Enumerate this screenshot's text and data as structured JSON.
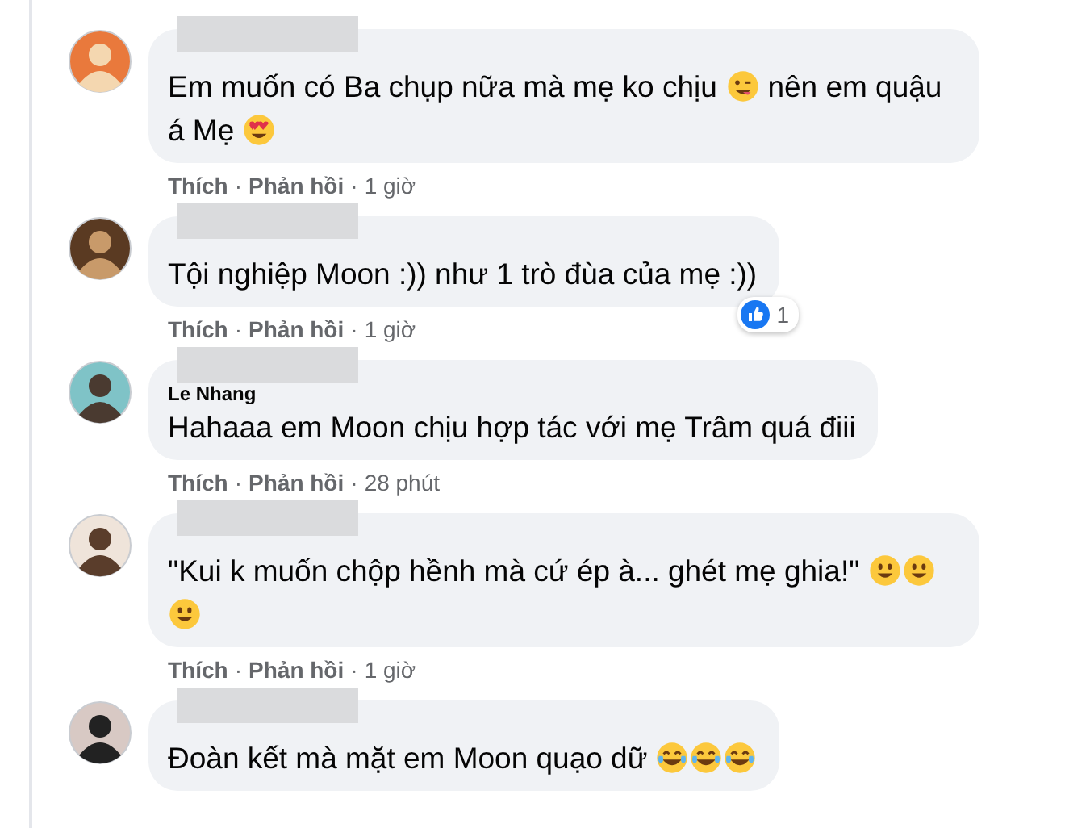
{
  "comments": [
    {
      "segments": [
        {
          "kind": "text",
          "text": "Em muốn có Ba chụp nữa mà mẹ ko chịu "
        },
        {
          "kind": "wink"
        },
        {
          "kind": "text",
          "text": " nên em quậu á Mẹ "
        },
        {
          "kind": "hearteyes"
        }
      ],
      "meta": [
        {
          "kind": "action",
          "text": "Thích"
        },
        {
          "kind": "sep",
          "text": "·"
        },
        {
          "kind": "action",
          "text": "Phản hồi"
        },
        {
          "kind": "sep",
          "text": "·"
        },
        {
          "kind": "time",
          "text": "1 giờ"
        }
      ]
    },
    {
      "segments": [
        {
          "kind": "text",
          "text": "Tội nghiệp Moon :)) như 1 trò đùa của mẹ :))"
        }
      ],
      "reaction": {
        "count": "1"
      },
      "meta": [
        {
          "kind": "action",
          "text": "Thích"
        },
        {
          "kind": "sep",
          "text": "·"
        },
        {
          "kind": "action",
          "text": "Phản hồi"
        },
        {
          "kind": "sep",
          "text": "·"
        },
        {
          "kind": "time",
          "text": "1 giờ"
        }
      ]
    },
    {
      "author": "Le Nhang",
      "segments": [
        {
          "kind": "text",
          "text": "Hahaaa em Moon chịu hợp tác với mẹ Trâm quá điii"
        }
      ],
      "meta": [
        {
          "kind": "action",
          "text": "Thích"
        },
        {
          "kind": "sep",
          "text": "·"
        },
        {
          "kind": "action",
          "text": "Phản hồi"
        },
        {
          "kind": "sep",
          "text": "·"
        },
        {
          "kind": "time",
          "text": "28 phút"
        }
      ]
    },
    {
      "segments": [
        {
          "kind": "text",
          "text": "\"Kui k muốn chộp hềnh mà cứ ép à... ghét mẹ ghia!\" "
        },
        {
          "kind": "smile"
        },
        {
          "kind": "smile"
        },
        {
          "kind": "smile"
        }
      ],
      "meta": [
        {
          "kind": "action",
          "text": "Thích"
        },
        {
          "kind": "sep",
          "text": "·"
        },
        {
          "kind": "action",
          "text": "Phản hồi"
        },
        {
          "kind": "sep",
          "text": "·"
        },
        {
          "kind": "time",
          "text": "1 giờ"
        }
      ]
    },
    {
      "segments": [
        {
          "kind": "text",
          "text": "Đoàn kết mà mặt em Moon quạo dữ "
        },
        {
          "kind": "laughcry"
        },
        {
          "kind": "laughcry"
        },
        {
          "kind": "laughcry"
        }
      ]
    }
  ]
}
